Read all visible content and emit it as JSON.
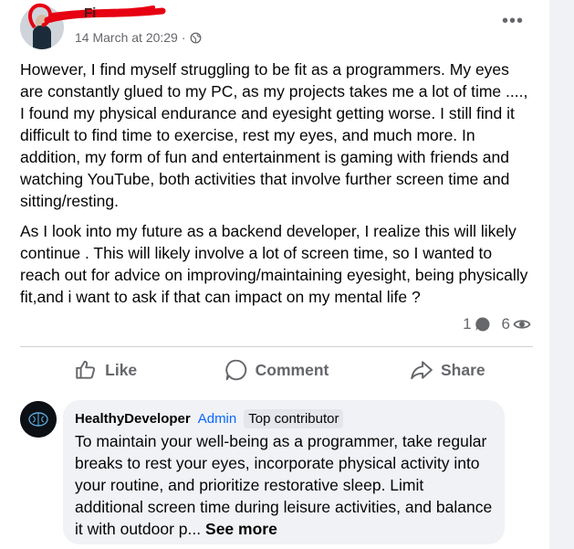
{
  "post": {
    "author_name": "Fi",
    "timestamp": "14 March at 20:29",
    "separator": "·",
    "paragraphs": [
      "However, I find myself struggling to be fit as a programmers. My eyes are constantly glued to my PC, as my projects takes me a lot of time ...., I found my physical endurance and eyesight getting worse. I still find it difficult to find time to exercise, rest my eyes, and much more. In addition, my form of fun and entertainment is gaming with friends and watching YouTube, both activities that involve further screen time and sitting/resting.",
      "As I look into my future as a backend developer, I realize this will likely continue . This will likely involve a lot of screen time, so I wanted to reach out for advice on improving/maintaining eyesight, being physically fit,and i want to ask if that can impact on my mental life  ?"
    ],
    "comment_count": "1",
    "view_count": "6"
  },
  "actions": {
    "like": "Like",
    "comment": "Comment",
    "share": "Share"
  },
  "comment": {
    "author": "HealthyDeveloper",
    "role": "Admin",
    "badge": "Top contributor",
    "text": "To maintain your well-being as a programmer, take regular breaks to rest your eyes, incorporate physical activity into your routine, and prioritize restorative sleep. Limit additional screen time during leisure activities, and balance it with outdoor p...",
    "see_more": "See more"
  },
  "icons": [
    "globe-icon",
    "more-options-icon",
    "comment-count-icon",
    "view-count-icon",
    "like-icon",
    "comment-icon",
    "share-icon"
  ],
  "colors": {
    "accent": "#0866ff",
    "secondary_text": "#65676b",
    "bubble": "#f0f2f5"
  }
}
